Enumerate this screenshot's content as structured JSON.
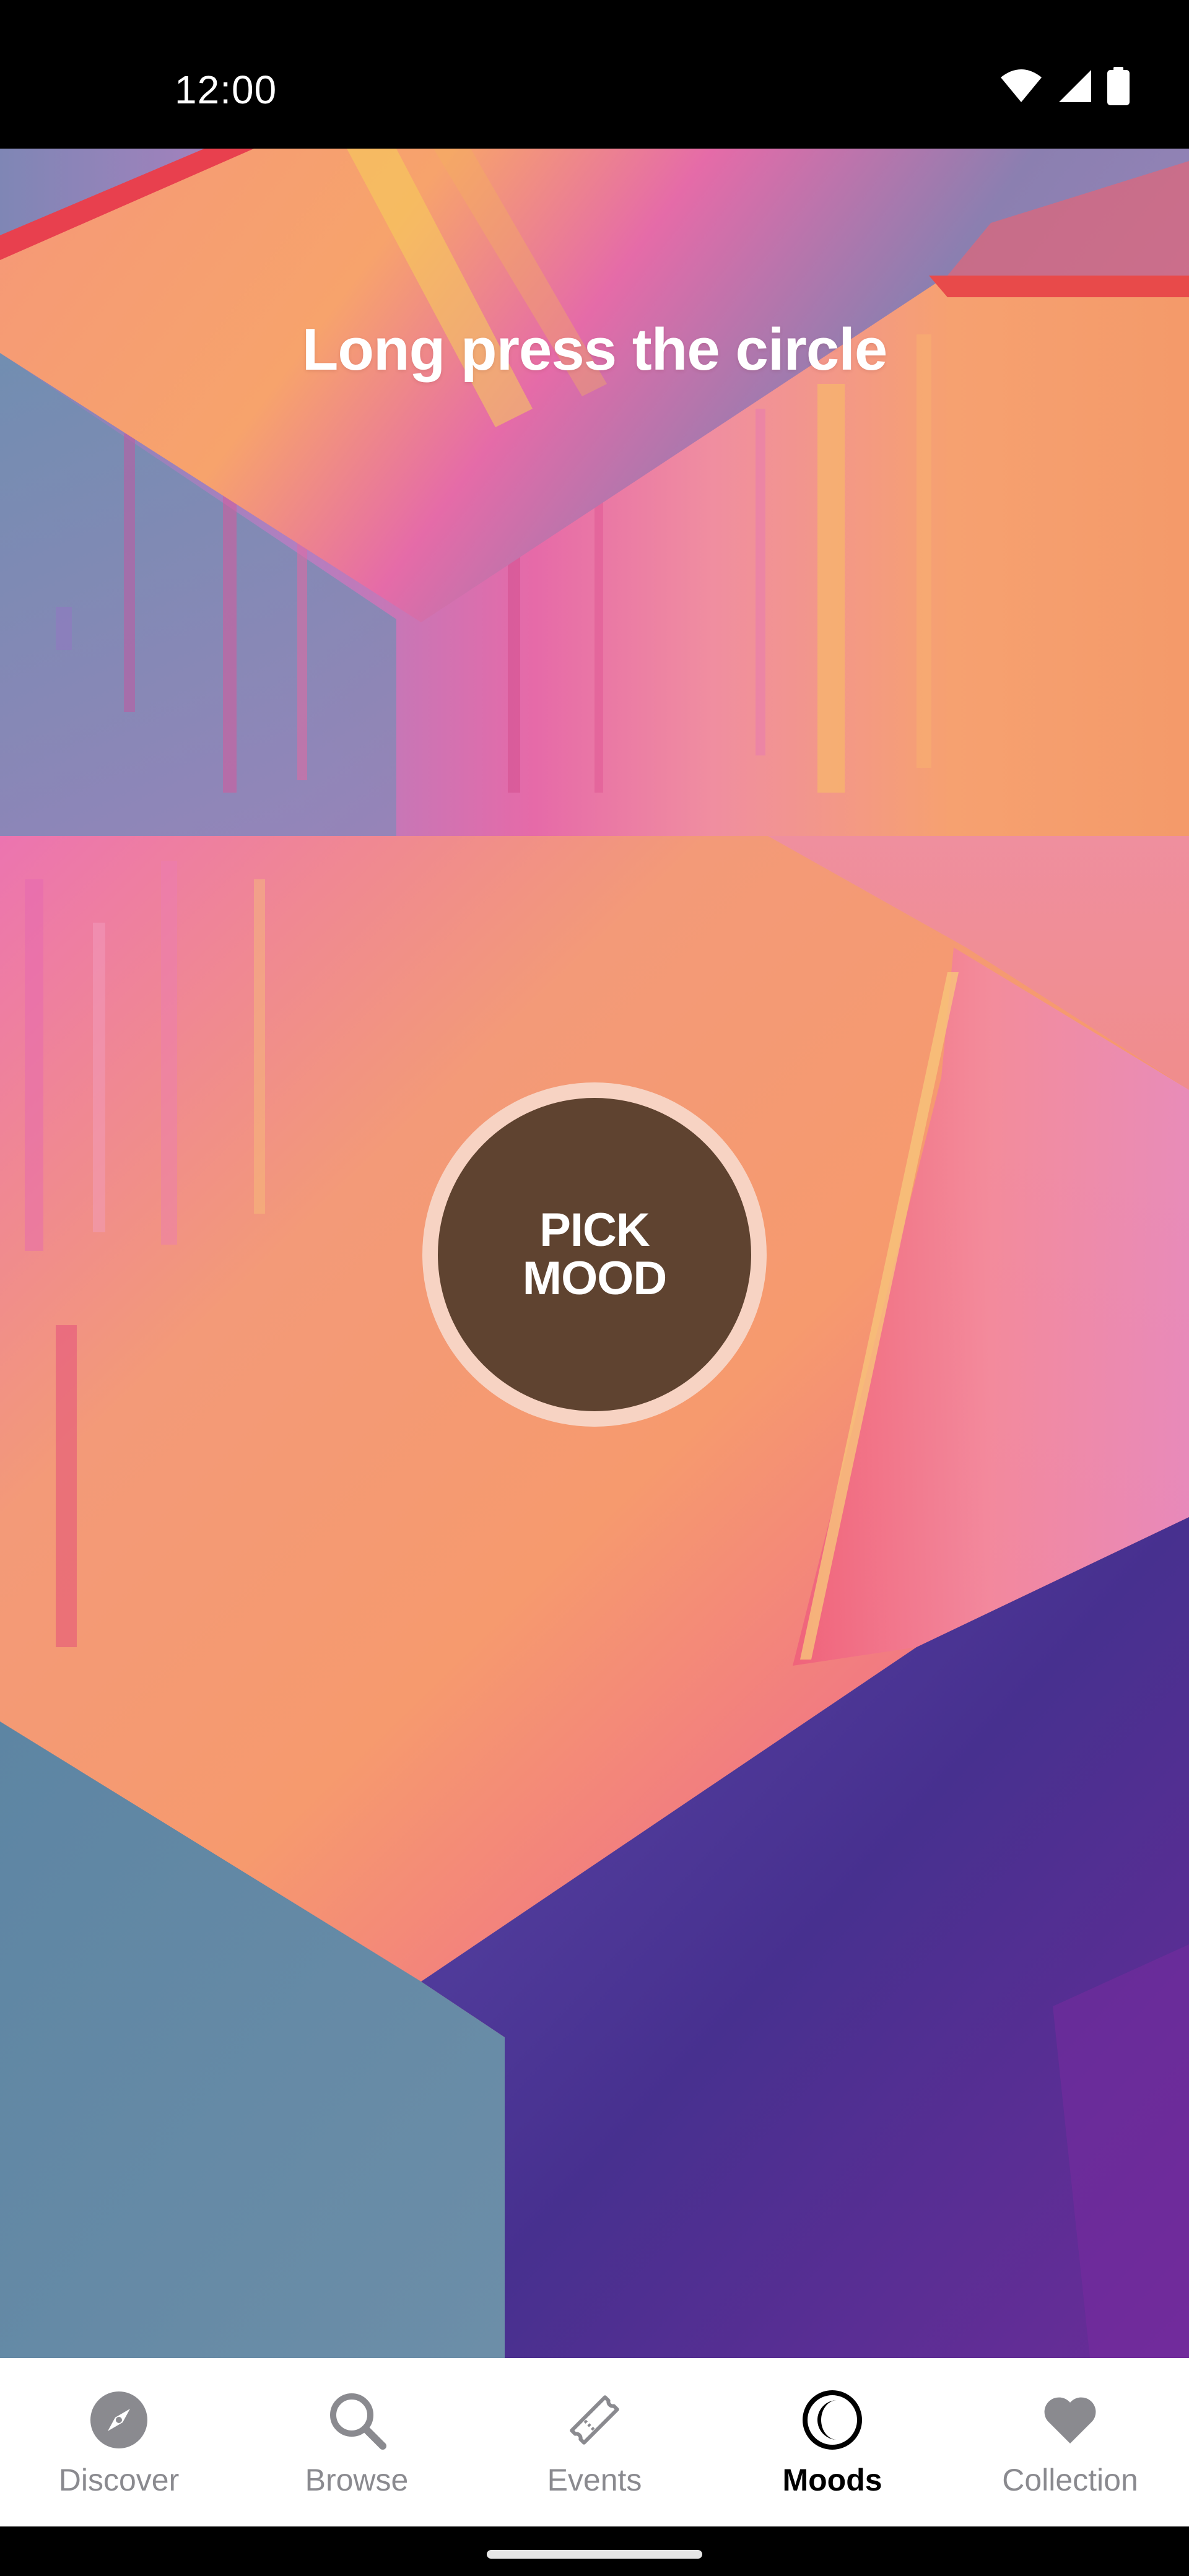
{
  "status_bar": {
    "time": "12:00",
    "icons": [
      "wifi-icon",
      "cellular-signal-icon",
      "battery-icon"
    ]
  },
  "mood_screen": {
    "instruction": "Long press the circle",
    "pick_button": {
      "line1": "PICK",
      "line2": "MOOD"
    }
  },
  "bottom_nav": {
    "items": [
      {
        "label": "Discover",
        "icon": "compass-icon",
        "active": false
      },
      {
        "label": "Browse",
        "icon": "search-icon",
        "active": false
      },
      {
        "label": "Events",
        "icon": "ticket-icon",
        "active": false
      },
      {
        "label": "Moods",
        "icon": "moon-icon",
        "active": true
      },
      {
        "label": "Collection",
        "icon": "heart-icon",
        "active": false
      }
    ]
  },
  "colors": {
    "nav_inactive": "#8a8a8f",
    "nav_active": "#000000",
    "pick_ring": "#f7d3c3",
    "pick_fill": "#5f4330"
  }
}
